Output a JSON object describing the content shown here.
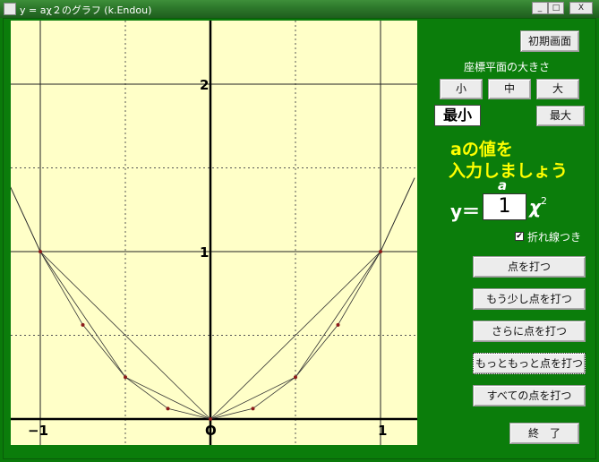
{
  "window": {
    "title": "y = aχ２のグラフ (k.Endou)",
    "controls": {
      "minimize": "_",
      "maximize": "□",
      "close": "X"
    }
  },
  "panel": {
    "reset_button": "初期画面",
    "size_heading": "座標平面の大きさ",
    "size_small": "小",
    "size_medium": "中",
    "size_large": "大",
    "size_status": "最小",
    "size_max_button": "最大",
    "prompt_line1": "aの値を",
    "prompt_line2": "入力しましょう",
    "a_label": "a",
    "equation_y": "y＝",
    "a_value": "1",
    "equation_x": "χ",
    "equation_exp": "2",
    "polyline_label": "折れ線つき",
    "polyline_checked": true,
    "plot_button": "点を打つ",
    "more_button": "もう少し点を打つ",
    "further_button": "さらに点を打つ",
    "much_more_button": "もっともっと点を打つ",
    "all_button": "すべての点を打つ",
    "exit_button": "終　了"
  },
  "chart_data": {
    "type": "line",
    "function": "y = a x^2",
    "a": 1,
    "xlabel": "χ",
    "ylabel": "y",
    "xlim": [
      -1.15,
      1.2
    ],
    "ylim": [
      0,
      2.3
    ],
    "grid": true,
    "x_ticks": [
      -1,
      0,
      1
    ],
    "x_tick_labels": [
      "−1",
      "O",
      "1"
    ],
    "y_ticks": [
      1,
      2
    ],
    "y_tick_labels": [
      "1",
      "2"
    ],
    "points_x": [
      -1,
      -0.75,
      -0.5,
      -0.25,
      0,
      0.25,
      0.5,
      0.75,
      1
    ],
    "points_y": [
      1,
      0.5625,
      0.25,
      0.0625,
      0,
      0.0625,
      0.25,
      0.5625,
      1
    ],
    "polyline_levels": [
      [
        -1.2,
        -1,
        0,
        1,
        1.2
      ],
      [
        -1.2,
        -1,
        -0.5,
        0,
        0.5,
        1,
        1.2
      ],
      [
        -1.2,
        -1,
        -0.75,
        -0.5,
        -0.25,
        0,
        0.25,
        0.5,
        0.75,
        1,
        1.2
      ]
    ],
    "colors": {
      "background": "#ffffc8",
      "axis": "#000000",
      "grid": "#555555",
      "curve": "#333333",
      "point": "#8b1a1a"
    }
  }
}
